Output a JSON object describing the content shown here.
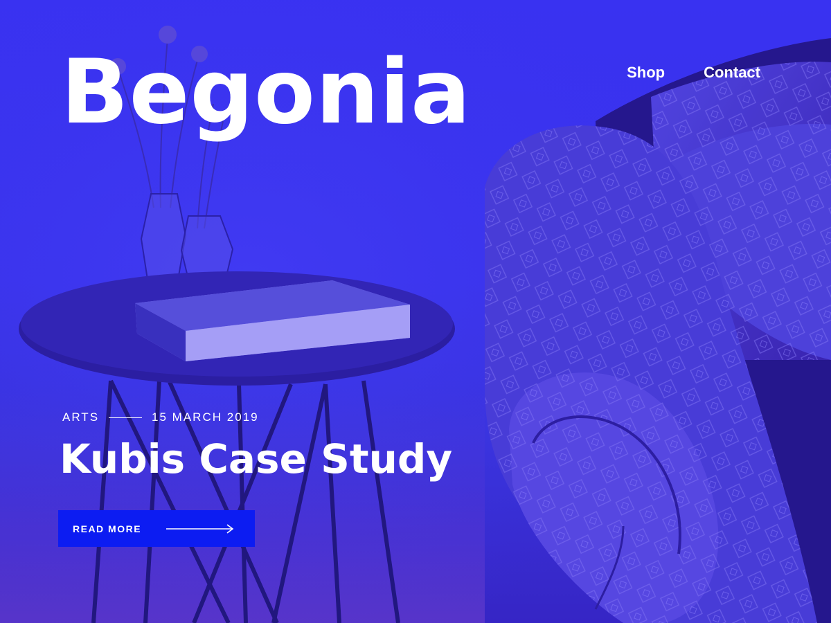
{
  "header": {
    "logo": "Begonia",
    "nav": [
      {
        "label": "Shop"
      },
      {
        "label": "Contact"
      }
    ]
  },
  "post": {
    "category": "ARTS",
    "date": "15 MARCH 2019",
    "title": "Kubis Case Study",
    "cta_label": "READ MORE",
    "cta_icon": "arrow-right-icon"
  },
  "colors": {
    "background": "#3a33f2",
    "button": "#0c1cf2",
    "text": "#ffffff"
  }
}
